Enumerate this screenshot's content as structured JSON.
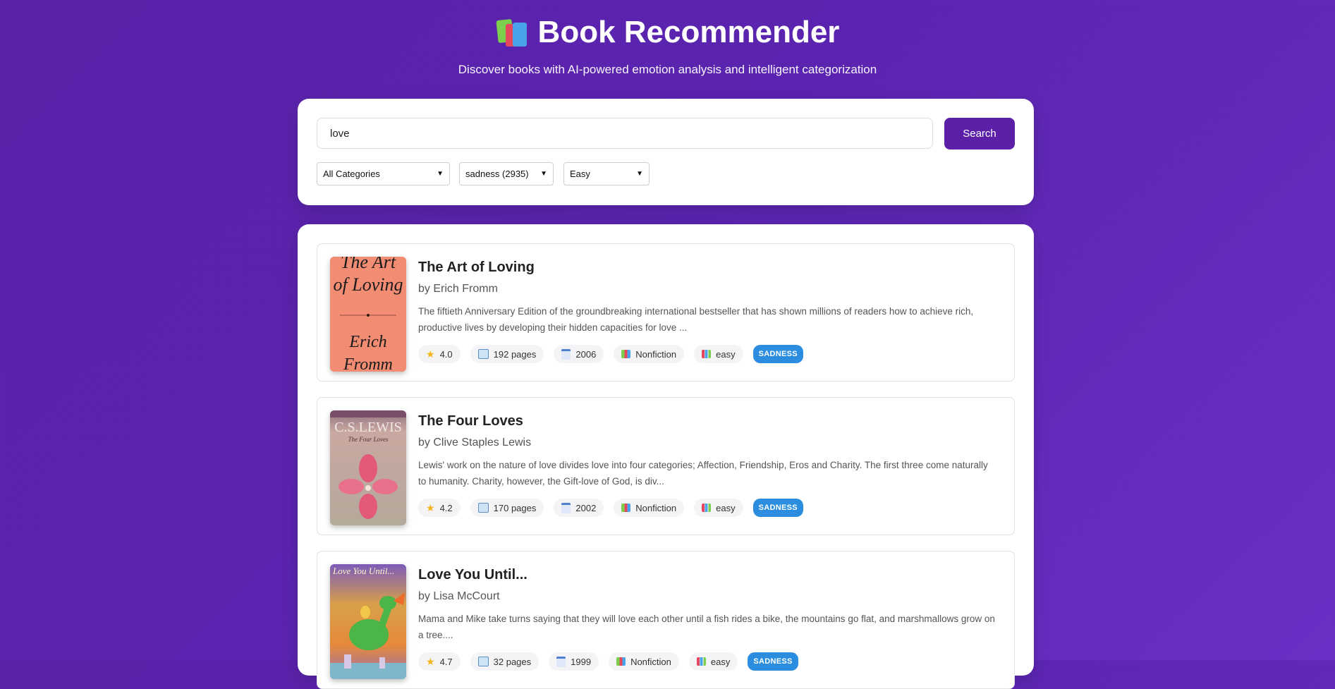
{
  "header": {
    "icon": "books-icon",
    "title": "Book Recommender",
    "subtitle": "Discover books with AI-powered emotion analysis and intelligent categorization"
  },
  "search": {
    "query": "love",
    "button_label": "Search",
    "filters": {
      "category": "All Categories",
      "emotion": "sadness (2935)",
      "difficulty": "Easy"
    }
  },
  "colors": {
    "background": "#5b24b0",
    "button": "#5b1fa8",
    "emotion_badge": "#2a8de0"
  },
  "books": [
    {
      "title": "The Art of Loving",
      "author": "by Erich Fromm",
      "description": "The fiftieth Anniversary Edition of the groundbreaking international bestseller that has shown millions of readers how to achieve rich, productive lives by developing their hidden capacities for love ...",
      "rating": "4.0",
      "pages": "192 pages",
      "year": "2006",
      "category": "Nonfiction",
      "difficulty": "easy",
      "emotion": "SADNESS",
      "cover_text": [
        "The Art",
        "of Loving",
        "Erich",
        "Fromm"
      ]
    },
    {
      "title": "The Four Loves",
      "author": "by Clive Staples Lewis",
      "description": "Lewis' work on the nature of love divides love into four categories; Affection, Friendship, Eros and Charity. The first three come naturally to humanity. Charity, however, the Gift-love of God, is div...",
      "rating": "4.2",
      "pages": "170 pages",
      "year": "2002",
      "category": "Nonfiction",
      "difficulty": "easy",
      "emotion": "SADNESS",
      "cover_text": [
        "C.S.LEWIS",
        "The Four Loves"
      ]
    },
    {
      "title": "Love You Until...",
      "author": "by Lisa McCourt",
      "description": "Mama and Mike take turns saying that they will love each other until a fish rides a bike, the mountains go flat, and marshmallows grow on a tree....",
      "rating": "4.7",
      "pages": "32 pages",
      "year": "1999",
      "category": "Nonfiction",
      "difficulty": "easy",
      "emotion": "SADNESS",
      "cover_text": [
        "Love You Until..."
      ]
    }
  ]
}
